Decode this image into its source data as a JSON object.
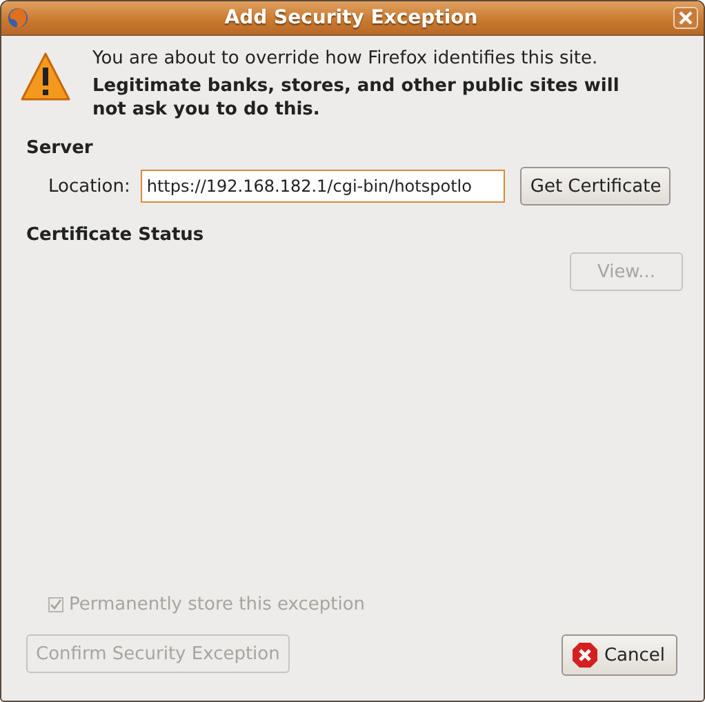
{
  "window": {
    "title": "Add Security Exception"
  },
  "warning": {
    "message": "You are about to override how Firefox identifies this site.",
    "emphasis": "Legitimate banks, stores, and other public sites will not ask you to do this."
  },
  "server": {
    "heading": "Server",
    "location_label": "Location:",
    "location_value": "https://192.168.182.1/cgi-bin/hotspotlo",
    "get_button": "Get Certificate"
  },
  "certificate_status": {
    "heading": "Certificate Status",
    "view_button": {
      "label": "View...",
      "disabled": true
    }
  },
  "permanent": {
    "label": "Permanently store this exception",
    "checked": true,
    "disabled": true
  },
  "buttons": [
    {
      "kind": "confirm",
      "label": "Confirm Security Exception",
      "disabled": true
    },
    {
      "kind": "cancel",
      "label": "Cancel",
      "disabled": false
    }
  ]
}
